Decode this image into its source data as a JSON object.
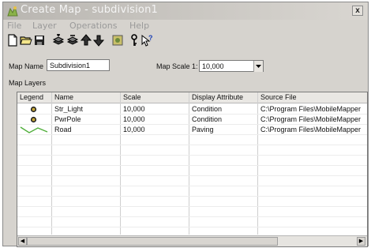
{
  "window": {
    "title": "Create Map - subdivision1",
    "close_label": "x"
  },
  "menu": {
    "items": [
      "File",
      "Layer",
      "Operations",
      "Help"
    ]
  },
  "toolbar": {
    "icons": [
      "new-file-icon",
      "open-folder-icon",
      "save-icon",
      "add-layer-icon",
      "remove-layer-icon",
      "move-up-icon",
      "move-down-icon",
      "properties-icon",
      "key-icon",
      "help-icon"
    ]
  },
  "form": {
    "map_name_label": "Map Name",
    "map_name_value": "Subdivision1",
    "map_scale_label": "Map Scale 1:",
    "map_scale_value": "10,000"
  },
  "layers": {
    "section_label": "Map Layers",
    "columns": [
      "Legend",
      "Name",
      "Scale",
      "Display Attribute",
      "Source File"
    ],
    "rows": [
      {
        "legend": "point-symbol-icon",
        "name": "Str_Light",
        "scale": "10,000",
        "display_attribute": "Condition",
        "source_file": "C:\\Program Files\\MobileMapper"
      },
      {
        "legend": "point-symbol-icon",
        "name": "PwrPole",
        "scale": "10,000",
        "display_attribute": "Condition",
        "source_file": "C:\\Program Files\\MobileMapper"
      },
      {
        "legend": "line-symbol-icon",
        "name": "Road",
        "scale": "10,000",
        "display_attribute": "Paving",
        "source_file": "C:\\Program Files\\MobileMapper"
      }
    ]
  },
  "colors": {
    "road_line": "#4fae3a",
    "point_ring": "#222222"
  }
}
